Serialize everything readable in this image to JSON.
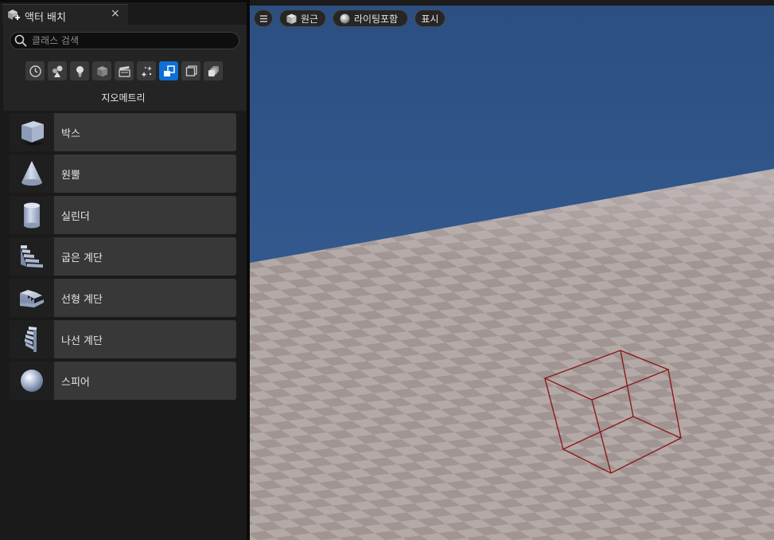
{
  "panel": {
    "tab_title": "액터 배치",
    "tab_close": "×",
    "search_placeholder": "클래스 검색",
    "category_label": "지오메트리",
    "filters": [
      {
        "icon": "recent-clock-icon",
        "active": false
      },
      {
        "icon": "basic-shapes-icon",
        "active": false
      },
      {
        "icon": "lightbulb-icon",
        "active": false
      },
      {
        "icon": "cube-icon",
        "active": false
      },
      {
        "icon": "clapperboard-icon",
        "active": false
      },
      {
        "icon": "sparkles-icon",
        "active": false
      },
      {
        "icon": "geometry-icon",
        "active": true
      },
      {
        "icon": "volume-icon",
        "active": false
      },
      {
        "icon": "all-classes-icon",
        "active": false
      }
    ],
    "items": [
      {
        "label": "박스",
        "icon": "box-icon"
      },
      {
        "label": "원뿔",
        "icon": "cone-icon"
      },
      {
        "label": "실린더",
        "icon": "cylinder-icon"
      },
      {
        "label": "굽은 계단",
        "icon": "curved-stairs-icon"
      },
      {
        "label": "선형 계단",
        "icon": "linear-stairs-icon"
      },
      {
        "label": "나선 계단",
        "icon": "spiral-stairs-icon"
      },
      {
        "label": "스피어",
        "icon": "sphere-icon"
      }
    ]
  },
  "viewport": {
    "menu_icon": "hamburger-menu-icon",
    "perspective_label": "원근",
    "lighting_label": "라이팅포함",
    "show_label": "표시"
  },
  "colors": {
    "sky": "#2f5487",
    "floor_light": "#b4aaa8",
    "floor_dark": "#9f9492",
    "active_filter": "#0e6fd6",
    "wire_box": "#8b1a1a"
  }
}
